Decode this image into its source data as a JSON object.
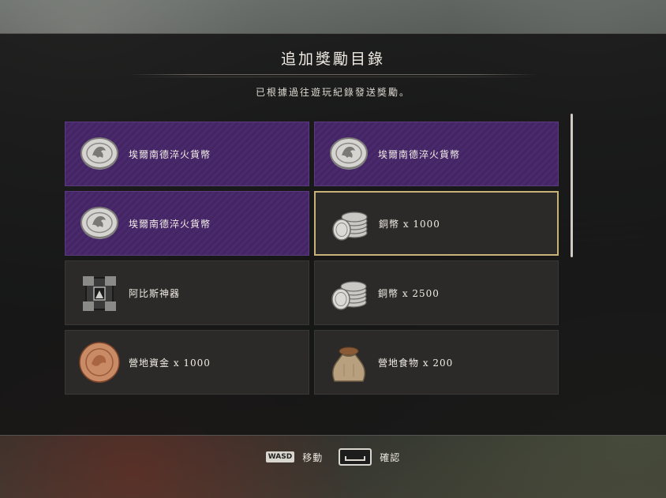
{
  "header": {
    "title": "追加獎勵目錄",
    "subtitle": "已根據過往遊玩紀錄發送獎勵。"
  },
  "rewards": [
    {
      "label": "埃爾南德淬火貨幣",
      "icon": "silver-medallion-icon",
      "rarity": "rare",
      "selected": false
    },
    {
      "label": "埃爾南德淬火貨幣",
      "icon": "silver-medallion-icon",
      "rarity": "rare",
      "selected": false
    },
    {
      "label": "埃爾南德淬火貨幣",
      "icon": "silver-medallion-icon",
      "rarity": "rare",
      "selected": false
    },
    {
      "label": "銅幣 x 1000",
      "icon": "coin-stack-icon",
      "rarity": "common",
      "selected": true
    },
    {
      "label": "阿比斯神器",
      "icon": "abyss-artifact-icon",
      "rarity": "common",
      "selected": false
    },
    {
      "label": "銅幣 x 2500",
      "icon": "coin-stack-icon",
      "rarity": "common",
      "selected": false
    },
    {
      "label": "營地資金 x 1000",
      "icon": "copper-coin-icon",
      "rarity": "common",
      "selected": false
    },
    {
      "label": "營地食物 x 200",
      "icon": "food-sack-icon",
      "rarity": "common",
      "selected": false
    }
  ],
  "footer": {
    "move_key": "WASD",
    "move_label": "移動",
    "confirm_label": "確認"
  },
  "colors": {
    "rare_bg": "#4a2a6c",
    "common_bg": "#2c2a28",
    "selected_border": "#c9b27a"
  }
}
